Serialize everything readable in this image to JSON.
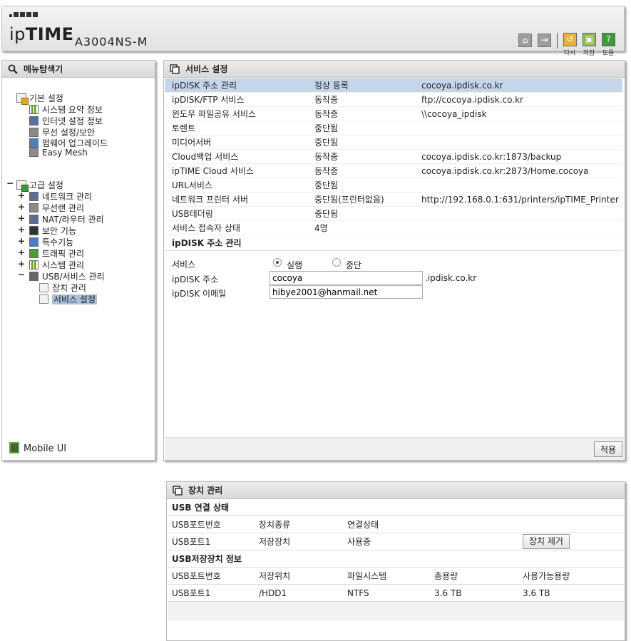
{
  "header": {
    "logo_prefix": "ip",
    "logo_suffix": "TIME",
    "model": "A3004NS-M",
    "buttons": {
      "undo_label": "다시",
      "save_label": "저장",
      "help_label": "도움"
    },
    "colors": {
      "undo": "#e8b33a",
      "save": "#8cbf4f",
      "help": "#3c9a3c"
    }
  },
  "menu": {
    "title": "메뉴탐색기",
    "basic": {
      "label": "기본 설정",
      "items": [
        "시스템 요약 정보",
        "인터넷 설정 정보",
        "무선 설정/보안",
        "펌웨어 업그레이드",
        "Easy Mesh"
      ]
    },
    "advanced": {
      "toggle": "−",
      "label": "고급 설정",
      "items": [
        "네트워크 관리",
        "무선랜 관리",
        "NAT/라우터 관리",
        "보안 기능",
        "특수기능",
        "트래픽 관리",
        "시스템 관리",
        "USB/서비스 관리"
      ],
      "usb_children": [
        "장치 관리",
        "서비스 설정"
      ]
    },
    "mobile_ui": "Mobile UI"
  },
  "service": {
    "title": "서비스 설정",
    "rows": [
      {
        "name": "ipDISK 주소 관리",
        "status": "정상 등록",
        "info": "cocoya.ipdisk.co.kr"
      },
      {
        "name": "ipDISK/FTP 서비스",
        "status": "동작중",
        "info": "ftp://cocoya.ipdisk.co.kr"
      },
      {
        "name": "윈도우 파일공유 서비스",
        "status": "동작중",
        "info": "\\\\cocoya_ipdisk"
      },
      {
        "name": "토렌트",
        "status": "중단됨",
        "info": ""
      },
      {
        "name": "미디어서버",
        "status": "중단됨",
        "info": ""
      },
      {
        "name": "Cloud백업 서비스",
        "status": "동작중",
        "info": "cocoya.ipdisk.co.kr:1873/backup"
      },
      {
        "name": "ipTIME Cloud 서비스",
        "status": "동작중",
        "info": "cocoya.ipdisk.co.kr:2873/Home.cocoya"
      },
      {
        "name": "URL서비스",
        "status": "중단됨",
        "info": ""
      },
      {
        "name": "네트워크 프린터 서버",
        "status": "중단됨(프린터없음)",
        "info": "http://192.168.0.1:631/printers/ipTIME_Printer"
      },
      {
        "name": "USB테더링",
        "status": "중단됨",
        "info": ""
      },
      {
        "name": "서비스 접속자 상태",
        "status": "4명",
        "info": ""
      }
    ],
    "ipdisk": {
      "section_title": "ipDISK 주소 관리",
      "service_label": "서비스",
      "run_label": "실행",
      "stop_label": "중단",
      "selected": "실행",
      "address_label": "ipDISK 주소",
      "address_value": "cocoya",
      "address_suffix": ".ipdisk.co.kr",
      "email_label": "ipDISK 이메일",
      "email_value": "hibye2001@hanmail.net"
    },
    "apply_label": "적용"
  },
  "device": {
    "title": "장치 관리",
    "usb_status": {
      "section_title": "USB 연결 상태",
      "headers": [
        "USB포트번호",
        "장치종류",
        "연결상태"
      ],
      "rows": [
        [
          "USB포트1",
          "저장장치",
          "사용중"
        ]
      ],
      "remove_label": "장치 제거"
    },
    "storage": {
      "section_title": "USB저장장치 정보",
      "headers": [
        "USB포트번호",
        "저장위치",
        "파일시스템",
        "총용량",
        "사용가능용량"
      ],
      "rows": [
        [
          "USB포트1",
          "/HDD1",
          "NTFS",
          "3.6 TB",
          "3.6 TB"
        ]
      ]
    }
  }
}
